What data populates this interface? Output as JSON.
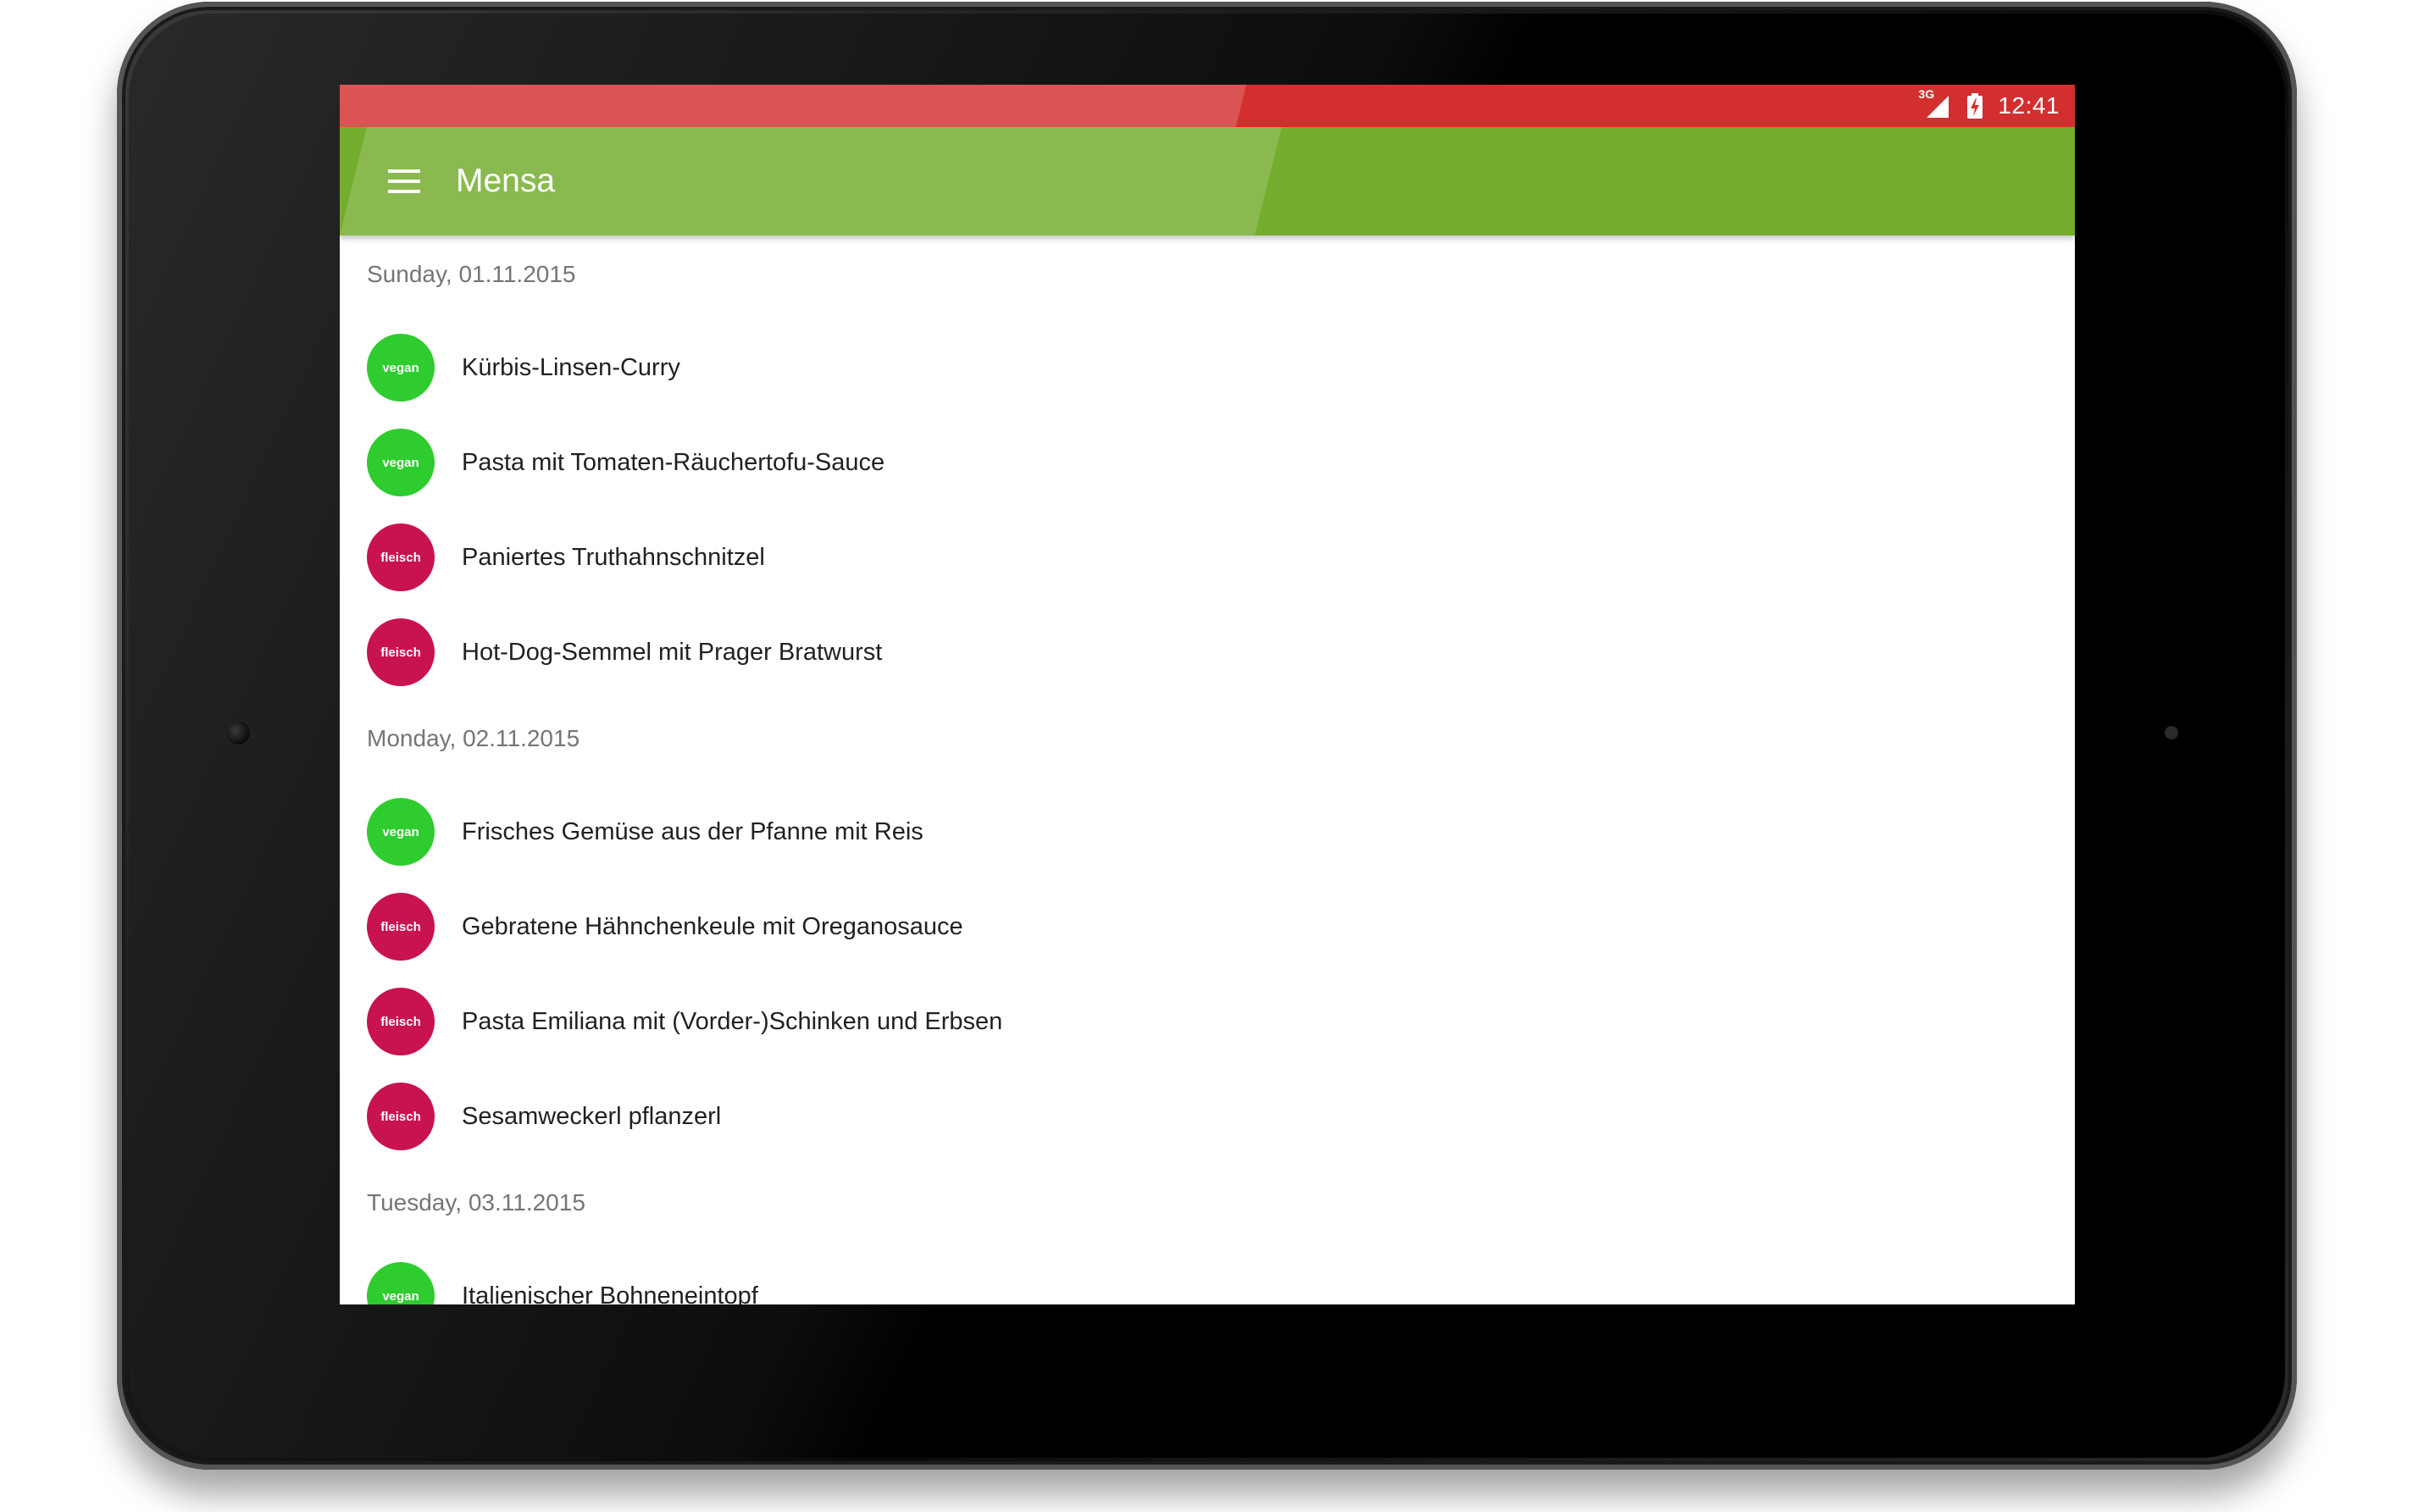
{
  "status_bar": {
    "network_type": "3G",
    "time": "12:41",
    "color": "#d32f2f"
  },
  "app_bar": {
    "title": "Mensa",
    "menu_icon": "hamburger-menu-icon",
    "color": "#74ad2e"
  },
  "days": [
    {
      "date": "Sunday, 01.11.2015",
      "meals": [
        {
          "badge": "vegan",
          "name": "Kürbis-Linsen-Curry"
        },
        {
          "badge": "vegan",
          "name": "Pasta mit Tomaten-Räuchertofu-Sauce"
        },
        {
          "badge": "fleisch",
          "name": "Paniertes Truthahnschnitzel"
        },
        {
          "badge": "fleisch",
          "name": "Hot-Dog-Semmel mit Prager Bratwurst"
        }
      ]
    },
    {
      "date": "Monday, 02.11.2015",
      "meals": [
        {
          "badge": "vegan",
          "name": "Frisches Gemüse aus der Pfanne mit Reis"
        },
        {
          "badge": "fleisch",
          "name": "Gebratene Hähnchenkeule mit Oreganosauce"
        },
        {
          "badge": "fleisch",
          "name": "Pasta Emiliana mit (Vorder-)Schinken und Erbsen"
        },
        {
          "badge": "fleisch",
          "name": "Sesamweckerl pflanzerl"
        }
      ]
    },
    {
      "date": "Tuesday, 03.11.2015",
      "meals": [
        {
          "badge": "vegan",
          "name": "Italienischer Bohneneintopf"
        }
      ]
    }
  ],
  "badge_colors": {
    "vegan": "#2ecc2e",
    "fleisch": "#c8134f"
  },
  "nav_bar": {
    "back_icon": "back-triangle-icon",
    "home_icon": "home-circle-icon",
    "recents_icon": "recents-square-icon"
  }
}
